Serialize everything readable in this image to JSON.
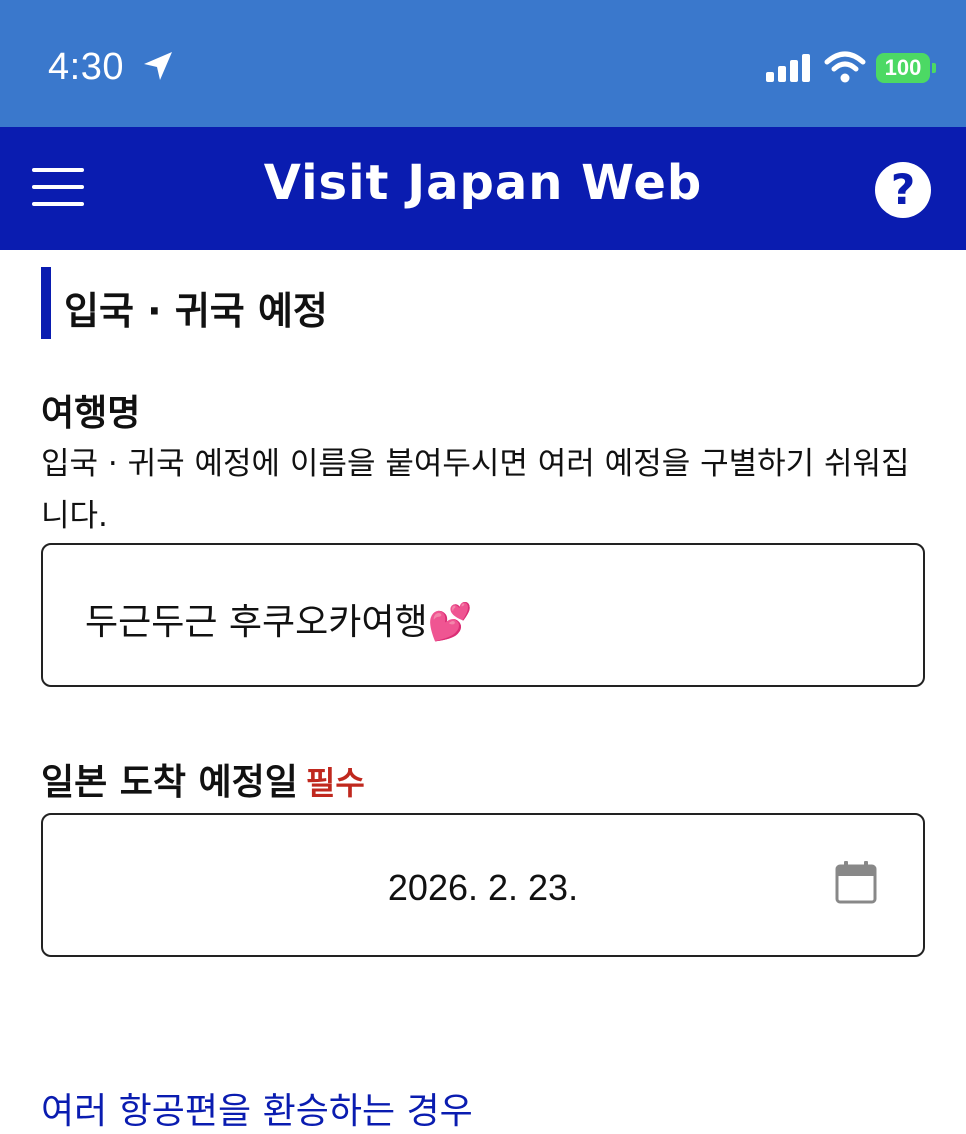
{
  "status_bar": {
    "time": "4:30",
    "battery": "100",
    "icons": [
      "location-arrow-icon",
      "signal-bars-icon",
      "wifi-icon",
      "battery-icon"
    ]
  },
  "header": {
    "title": "Visit Japan Web",
    "left_icon": "hamburger-menu-icon",
    "right_icon": "help-icon",
    "help_glyph": "?",
    "background_color": "#0a1cb0"
  },
  "section": {
    "title": "입국 · 귀국 예정"
  },
  "trip_name": {
    "label": "여행명",
    "description": "입국 · 귀국 예정에 이름을 붙여두시면 여러 예정을 구별하기 쉬워집니다.",
    "value": "두근두근 후쿠오카여행💕"
  },
  "arrival_date": {
    "label": "일본 도착 예정일",
    "required_label": "필수",
    "value": "2026. 2. 23.",
    "icon": "calendar-icon"
  },
  "bottom": {
    "link_text": "여러 항공편을 환승하는 경우"
  },
  "colors": {
    "status_bar": "#3a78cc",
    "accent": "#0a1cb0",
    "required": "#c0281e",
    "battery": "#4cd964"
  }
}
